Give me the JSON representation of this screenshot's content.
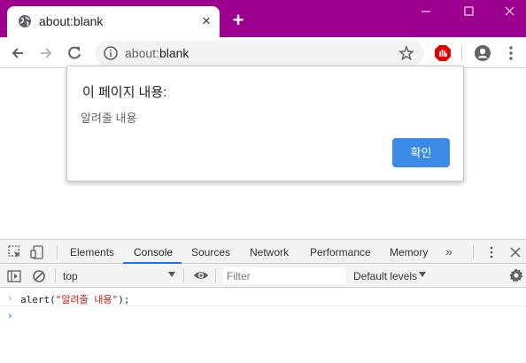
{
  "browser": {
    "tab": {
      "title": "about:blank",
      "favicon": "globe-icon",
      "close": "×"
    },
    "new_tab": "+",
    "window_controls": [
      "minimize-icon",
      "maximize-icon",
      "close-icon"
    ],
    "address": {
      "scheme_part": "about:",
      "path_part": "blank",
      "icon": "info-icon"
    },
    "theme_color": "#9b008f"
  },
  "dialog": {
    "title": "이 페이지 내용:",
    "message": "알려줄 내용",
    "ok_label": "확인",
    "ok_color": "#3b8ae6"
  },
  "devtools": {
    "tabs": [
      {
        "label": "Elements",
        "active": false
      },
      {
        "label": "Console",
        "active": true
      },
      {
        "label": "Sources",
        "active": false
      },
      {
        "label": "Network",
        "active": false
      },
      {
        "label": "Performance",
        "active": false
      },
      {
        "label": "Memory",
        "active": false
      }
    ],
    "more_tabs": "»",
    "context": "top",
    "filter_placeholder": "Filter",
    "levels": "Default levels",
    "console": {
      "fn": "alert(",
      "arg": "\"알려줄 내용\"",
      "close": ");"
    }
  }
}
